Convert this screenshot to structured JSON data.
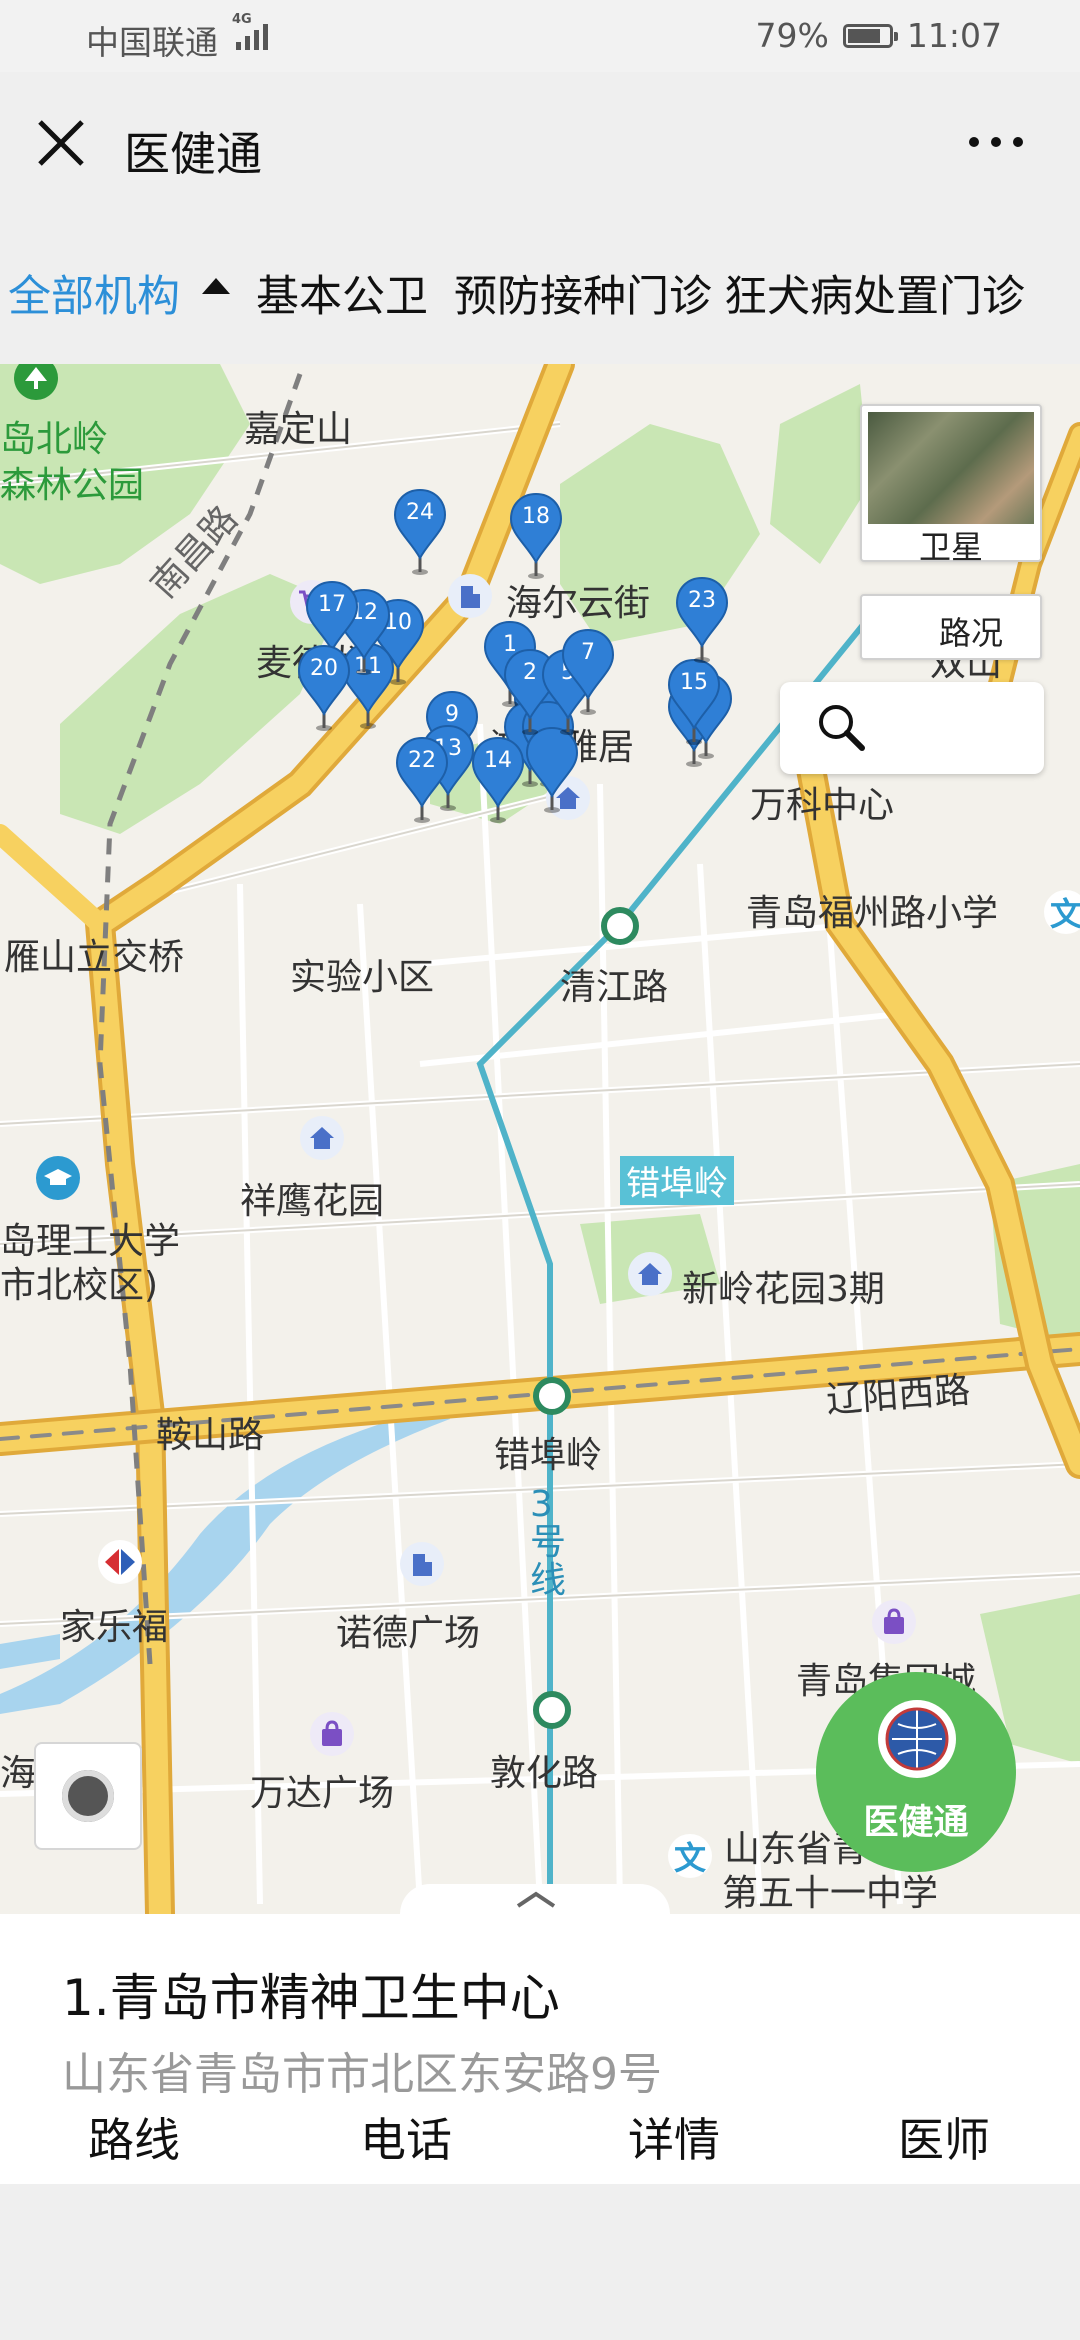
{
  "status_bar": {
    "carrier": "中国联通",
    "network": "4G",
    "battery_percent": "79%",
    "battery_level": 0.79,
    "time": "11:07"
  },
  "titlebar": {
    "title": "医健通",
    "close_icon": "close-icon",
    "more_icon": "more-dots-icon"
  },
  "tabs": [
    {
      "label": "全部机构",
      "active": true
    },
    {
      "label": "基本公卫",
      "active": false
    },
    {
      "label": "预防接种门诊",
      "active": false
    },
    {
      "label": "狂犬病处置门诊",
      "active": false
    }
  ],
  "map": {
    "labels": [
      {
        "text": "嘉定山",
        "style": "normal"
      },
      {
        "text": "岛北岭",
        "style": "green"
      },
      {
        "text": "森林公园",
        "style": "green"
      },
      {
        "text": "南昌路",
        "style": "normal"
      },
      {
        "text": "海尔云街",
        "style": "normal"
      },
      {
        "text": "麦德龙",
        "style": "normal"
      },
      {
        "text": "鸿仕雅居",
        "style": "normal"
      },
      {
        "text": "万科中心",
        "style": "normal"
      },
      {
        "text": "双山",
        "style": "normal"
      },
      {
        "text": "青岛福州路小学",
        "style": "normal"
      },
      {
        "text": "雁山立交桥",
        "style": "normal"
      },
      {
        "text": "实验小区",
        "style": "normal"
      },
      {
        "text": "清江路",
        "style": "normal"
      },
      {
        "text": "祥鹰花园",
        "style": "normal"
      },
      {
        "text": "岛理工大学",
        "style": "normal"
      },
      {
        "text": "市北校区)",
        "style": "normal"
      },
      {
        "text": "新岭花园3期",
        "style": "normal"
      },
      {
        "text": "辽阳西路",
        "style": "normal"
      },
      {
        "text": "鞍山路",
        "style": "normal"
      },
      {
        "text": "错埠岭",
        "style": "normal"
      },
      {
        "text": "3号线",
        "style": "blue"
      },
      {
        "text": "家乐福",
        "style": "normal"
      },
      {
        "text": "诺德广场",
        "style": "normal"
      },
      {
        "text": "青岛集团城",
        "style": "normal"
      },
      {
        "text": "敦化路",
        "style": "normal"
      },
      {
        "text": "万达广场",
        "style": "normal"
      },
      {
        "text": "山东省青",
        "style": "normal"
      },
      {
        "text": "第五十一中学",
        "style": "normal"
      },
      {
        "text": "海大",
        "style": "normal"
      }
    ],
    "metro_tag": "错埠岭",
    "pins": [
      "1",
      "2",
      "5",
      "7",
      "9",
      "10",
      "11",
      "12",
      "13",
      "14",
      "15",
      "17",
      "18",
      "20",
      "22",
      "23",
      "24"
    ],
    "layer_buttons": {
      "satellite": "卫星",
      "traffic": "路况"
    },
    "search_icon": "search-icon",
    "locate_icon": "locate-icon",
    "brand_badge": "医健通"
  },
  "detail": {
    "name": "1.青岛市精神卫生中心",
    "address": "山东省青岛市市北区东安路9号",
    "actions": [
      "路线",
      "电话",
      "详情",
      "医师"
    ]
  },
  "colors": {
    "accent_blue": "#2c8fd8",
    "pin_blue": "#2f7fd6",
    "brand_green": "#5bbd5b",
    "road_yellow": "#f4c44a",
    "metro_cyan": "#4fb3c9"
  }
}
